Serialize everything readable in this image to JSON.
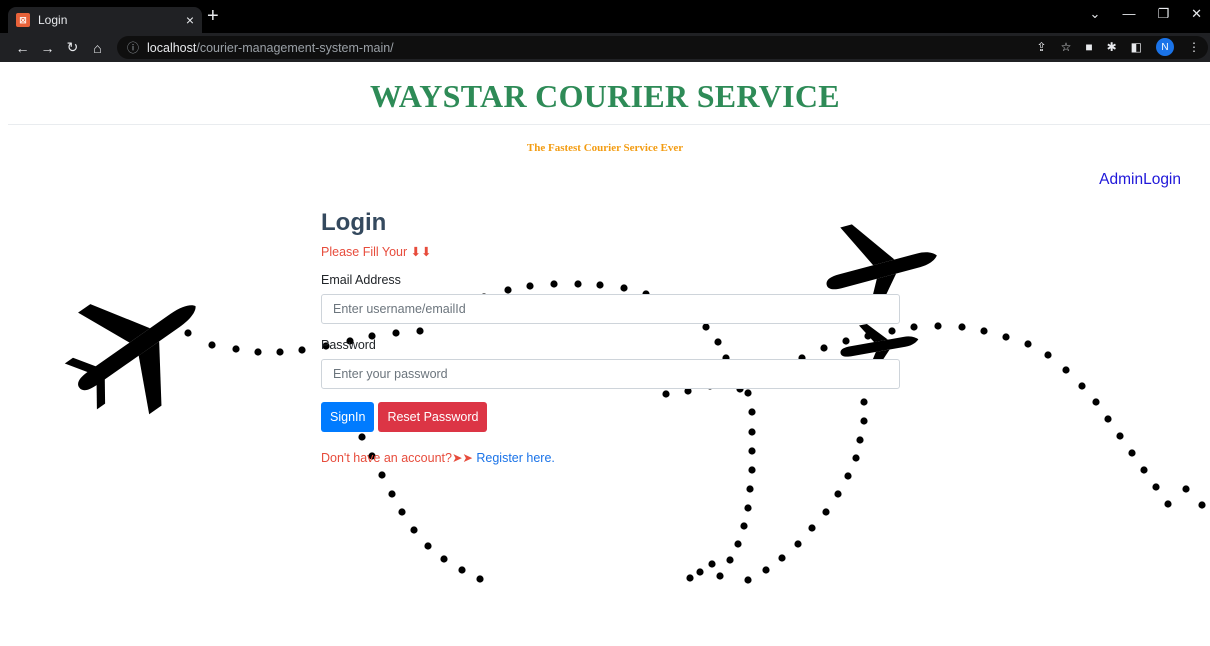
{
  "browser": {
    "tab_title": "Login",
    "tab_close": "×",
    "new_tab": "+",
    "favicon": "favicon-icon",
    "url_host": "localhost",
    "url_path": "/courier-management-system-main/",
    "profile_initial": "N"
  },
  "header": {
    "site_title": "WAYSTAR COURIER SERVICE",
    "tagline": "The Fastest Courier Service Ever",
    "admin_link": "AdminLogin"
  },
  "login": {
    "title": "Login",
    "fill_message": "Please Fill Your ⬇⬇",
    "email_label": "Email Address",
    "email_placeholder": "Enter username/emailId",
    "email_value": "",
    "password_label": "Password",
    "password_placeholder": "Enter your password",
    "password_value": "",
    "signin_label": "SignIn",
    "reset_label": "Reset Password",
    "register_question": "Don't have an account?➤➤ ",
    "register_link": "Register here."
  },
  "colors": {
    "title_green": "#2e8b57",
    "tagline_orange": "#f39c12",
    "admin_blue": "#1f17d9",
    "signin_blue": "#007bff",
    "reset_red": "#dc3545",
    "message_red": "#e74c3c"
  }
}
